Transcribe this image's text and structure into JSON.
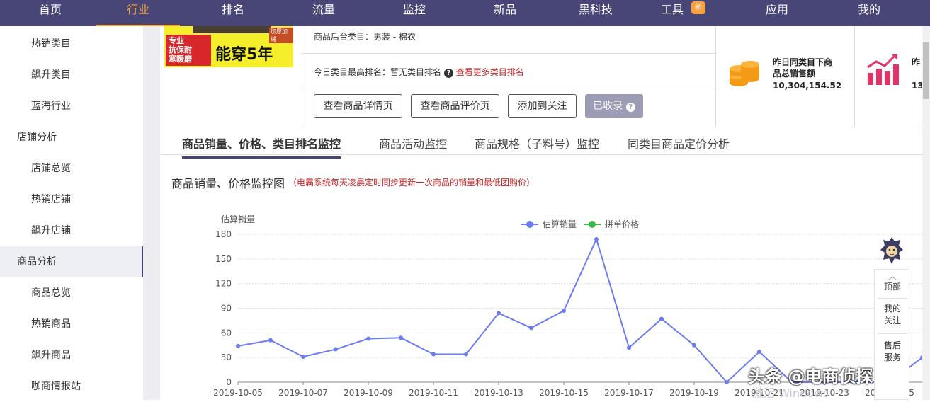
{
  "topnav": {
    "items": [
      {
        "label": "首页"
      },
      {
        "label": "行业"
      },
      {
        "label": "排名"
      },
      {
        "label": "流量"
      },
      {
        "label": "监控"
      },
      {
        "label": "新品"
      },
      {
        "label": "黑科技"
      },
      {
        "label": "工具",
        "badge": "新"
      },
      {
        "label": "应用"
      },
      {
        "label": "我的"
      }
    ],
    "active_index": 1,
    "bg_color": "#474677",
    "accent_color": "#f7a23b"
  },
  "sidebar": {
    "items": [
      {
        "label": "热销类目",
        "level": "sub"
      },
      {
        "label": "飙升类目",
        "level": "sub"
      },
      {
        "label": "蓝海行业",
        "level": "sub"
      },
      {
        "label": "店铺分析",
        "level": "head"
      },
      {
        "label": "店铺总览",
        "level": "sub"
      },
      {
        "label": "热销店铺",
        "level": "sub"
      },
      {
        "label": "飙升店铺",
        "level": "sub"
      },
      {
        "label": "商品分析",
        "level": "head",
        "active": true
      },
      {
        "label": "商品总览",
        "level": "sub"
      },
      {
        "label": "热销商品",
        "level": "sub"
      },
      {
        "label": "飙升商品",
        "level": "sub"
      },
      {
        "label": "咖商情报站",
        "level": "sub"
      }
    ]
  },
  "product": {
    "thumb_red_text": "专业\n抗保耐\n寒暖磨",
    "thumb_big_text": "能穿5年",
    "thumb_tag": "加厚加绒",
    "category_label": "商品后台类目：",
    "category_value": "男装 - 棉衣",
    "rank_label": "今日类目最高排名：",
    "rank_value": "暂无类目排名",
    "rank_link": "查看更多类目排名",
    "buttons": [
      "查看商品详情页",
      "查看商品评价页",
      "添加到关注",
      "已收录"
    ]
  },
  "stats": [
    {
      "label_line1": "昨日同类目下商",
      "label_line2": "品总销售额",
      "value": "10,304,154.52",
      "color": "#f49a16",
      "icon": "coin-stack-icon"
    },
    {
      "label_line1": "昨",
      "label_line2": "",
      "value": "13",
      "color": "#e5336a",
      "icon": "growth-chart-icon"
    }
  ],
  "tabs": [
    {
      "label": "商品销量、价格、类目排名监控",
      "active": true
    },
    {
      "label": "商品活动监控"
    },
    {
      "label": "商品规格（子料号）监控"
    },
    {
      "label": "同类目商品定价分析"
    }
  ],
  "section": {
    "title": "商品销量、价格监控图",
    "note": "（电霸系统每天凌晨定时同步更新一次商品的销量和最低团购价）"
  },
  "chart_data": {
    "type": "line",
    "ylabel": "估算销量",
    "ylim": [
      0,
      180
    ],
    "yticks": [
      0,
      30,
      60,
      90,
      120,
      150,
      180
    ],
    "x": [
      "2019-10-05",
      "2019-10-06",
      "2019-10-07",
      "2019-10-08",
      "2019-10-09",
      "2019-10-10",
      "2019-10-11",
      "2019-10-12",
      "2019-10-13",
      "2019-10-14",
      "2019-10-15",
      "2019-10-16",
      "2019-10-17",
      "2019-10-18",
      "2019-10-19",
      "2019-10-20",
      "2019-10-21",
      "2019-10-22",
      "2019-10-23",
      "2019-10-24",
      "2019-10-25",
      "2019-10-26"
    ],
    "xticks": [
      "2019-10-05",
      "2019-10-07",
      "2019-10-09",
      "2019-10-11",
      "2019-10-13",
      "2019-10-15",
      "2019-10-17",
      "2019-10-19",
      "2019-10-21",
      "2019-10-23",
      "2019-10-25"
    ],
    "series": [
      {
        "name": "估算销量",
        "color": "#6b7cf2",
        "values": [
          44,
          51,
          31,
          40,
          53,
          54,
          34,
          34,
          84,
          66,
          87,
          174,
          42,
          77,
          45,
          0,
          37,
          0,
          0,
          0,
          0,
          30
        ]
      },
      {
        "name": "拼单价格",
        "color": "#3cb84a",
        "values": []
      }
    ],
    "legend": "top-center",
    "grid": true
  },
  "float_panel": {
    "items": [
      "顶部",
      "我的\n关注",
      "售后\n服务"
    ]
  },
  "watermark": {
    "text": "头条 @电商侦探",
    "sub": "激活 Windows"
  }
}
